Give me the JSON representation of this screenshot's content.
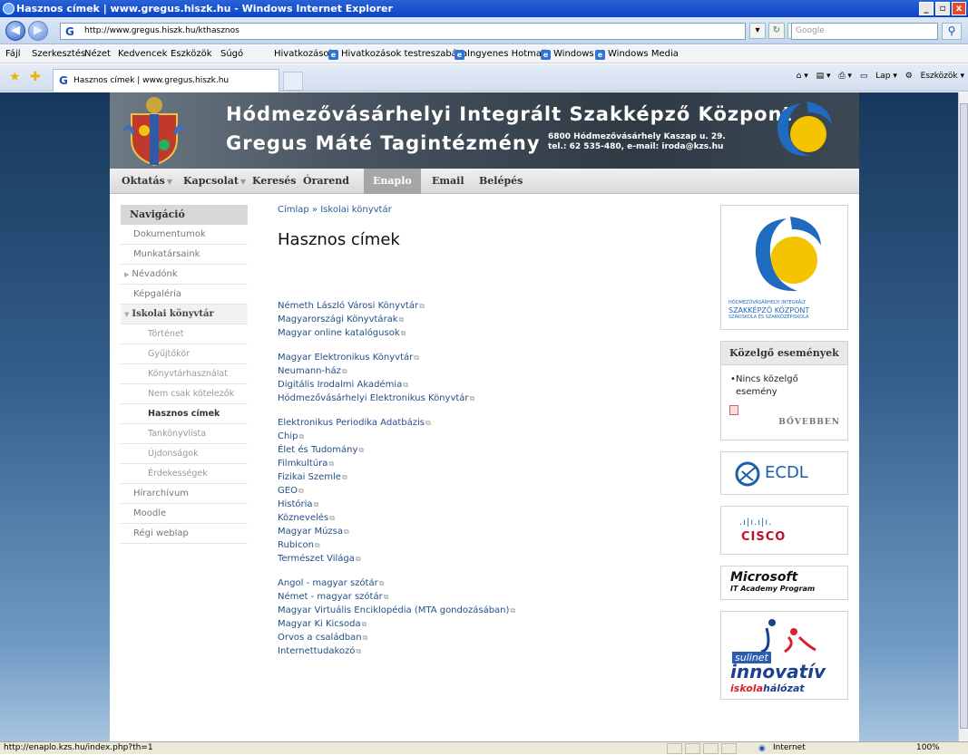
{
  "window": {
    "title": "Hasznos címek | www.gregus.hiszk.hu - Windows Internet Explorer"
  },
  "browser": {
    "address": "http://www.gregus.hiszk.hu/kthasznos",
    "search_placeholder": "Google",
    "menu": [
      "Fájl",
      "Szerkesztés",
      "Nézet",
      "Kedvencek",
      "Eszközök",
      "Súgó"
    ],
    "favorites": [
      "Hivatkozások",
      "Hivatkozások testreszabása",
      "Ingyenes Hotmail",
      "Windows",
      "Windows Media"
    ],
    "tab_title": "Hasznos címek | www.gregus.hiszk.hu",
    "commands": [
      "Lap",
      "Eszközök"
    ],
    "status_url": "http://enaplo.kzs.hu/index.php?th=1",
    "zone": "Internet",
    "zoom": "100%"
  },
  "banner": {
    "title1": "Hódmezővásárhelyi Integrált Szakképző Központ",
    "title2": "Gregus Máté Tagintézmény",
    "address1": "6800 Hódmezővásárhely Kaszap u. 29.",
    "address2": "tel.: 62 535-480, e-mail: iroda@kzs.hu"
  },
  "topnav": [
    "Oktatás",
    "Kapcsolat",
    "Keresés",
    "Órarend",
    "Enaplo",
    "Email",
    "Belépés"
  ],
  "leftnav": {
    "title": "Navigáció",
    "items": [
      "Dokumentumok",
      "Munkatársaink",
      "Névadónk",
      "Képgaléria",
      "Iskolai könyvtár"
    ],
    "subitems": [
      "Történet",
      "Gyűjtőkör",
      "Könyvtárhasználat",
      "Nem csak kötelezők",
      "Hasznos címek",
      "Tankönyvlista",
      "Újdonságok",
      "Érdekességek"
    ],
    "bottom": [
      "Hírarchívum",
      "Moodle",
      "Régi weblap"
    ]
  },
  "content": {
    "breadcrumb": "Címlap » Iskolai könyvtár",
    "title": "Hasznos címek",
    "groups": [
      [
        "Németh László Városi Könyvtár",
        "Magyarországi Könyvtárak",
        "Magyar online katalógusok"
      ],
      [
        "Magyar Elektronikus Könyvtár",
        "Neumann-ház",
        "Digitális Irodalmi Akadémia",
        "Hódmezővásárhelyi Elektronikus Könyvtár"
      ],
      [
        "Elektronikus Periodika Adatbázis",
        "Chip",
        "Élet és Tudomány",
        "Filmkultúra",
        "Fizikai Szemle",
        "GEO",
        "História",
        "Köznevelés",
        "Magyar Múzsa",
        "Rubicon",
        "Természet Világa"
      ],
      [
        "Angol - magyar szótár",
        "Német - magyar szótár",
        "Magyar Virtuális Enciklopédia (MTA gondozásában)",
        "Magyar Ki Kicsoda",
        "Orvos a családban",
        "Internettudakozó"
      ]
    ]
  },
  "sidebar": {
    "logo_text1": "HÓDMEZŐVÁSÁRHELYI INTEGRÁLT",
    "logo_text2": "SZAKKÉPZŐ KÖZPONT",
    "logo_text3": "SZAKISKOLA ÉS SZAKKÖZÉPISKOLA",
    "events_title": "Közelgő események",
    "events_item": "Nincs közelgő esemény",
    "more": "BŐVEBBEN",
    "ecdl": "ECDL",
    "cisco": "CISCO",
    "ms1": "Microsoft",
    "ms2": "IT Academy Program",
    "sulinet": "sulinet",
    "innovativ": "innovatív",
    "iskola": "iskola",
    "halozat": "hálózat"
  },
  "colors": {
    "link": "#234f8a",
    "ie_title": "#0b44c6",
    "school_yellow": "#f5c400",
    "school_blue": "#1e6bbf"
  }
}
